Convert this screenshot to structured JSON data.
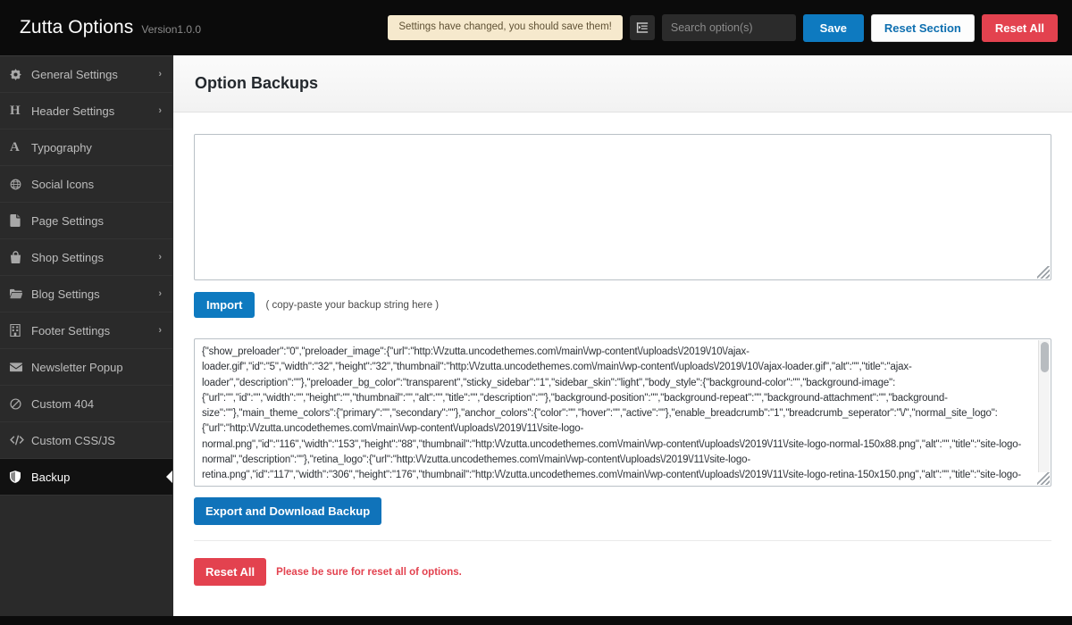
{
  "header": {
    "brand_title": "Zutta Options",
    "version": "Version1.0.0",
    "notice": "Settings have changed, you should save them!",
    "collapse_icon": "collapse-sidebar-icon",
    "search_placeholder": "Search option(s)",
    "search_value": "",
    "save_label": "Save",
    "reset_section_label": "Reset Section",
    "reset_all_label": "Reset All",
    "colors": {
      "bar_bg": "#0b0b0b",
      "notice_bg": "#f6e9cd",
      "primary_blue": "#0e7ac0",
      "danger_red": "#e3424f"
    }
  },
  "sidebar": {
    "items": [
      {
        "label": "General Settings",
        "icon": "gear-icon",
        "has_arrow": true,
        "active": false
      },
      {
        "label": "Header Settings",
        "icon": "letter-h-icon",
        "has_arrow": true,
        "active": false
      },
      {
        "label": "Typography",
        "icon": "letter-a-icon",
        "has_arrow": false,
        "active": false
      },
      {
        "label": "Social Icons",
        "icon": "globe-icon",
        "has_arrow": false,
        "active": false
      },
      {
        "label": "Page Settings",
        "icon": "page-file-icon",
        "has_arrow": false,
        "active": false
      },
      {
        "label": "Shop Settings",
        "icon": "shopping-bag-icon",
        "has_arrow": true,
        "active": false
      },
      {
        "label": "Blog Settings",
        "icon": "folder-icon",
        "has_arrow": true,
        "active": false
      },
      {
        "label": "Footer Settings",
        "icon": "building-columns-icon",
        "has_arrow": true,
        "active": false
      },
      {
        "label": "Newsletter Popup",
        "icon": "envelope-icon",
        "has_arrow": false,
        "active": false
      },
      {
        "label": "Custom 404",
        "icon": "ban-icon",
        "has_arrow": false,
        "active": false
      },
      {
        "label": "Custom CSS/JS",
        "icon": "code-icon",
        "has_arrow": false,
        "active": false
      },
      {
        "label": "Backup",
        "icon": "shield-icon",
        "has_arrow": false,
        "active": true
      }
    ],
    "arrow_glyph": "›"
  },
  "main": {
    "page_title": "Option Backups",
    "import_textarea_value": "",
    "import_button_label": "Import",
    "import_hint": "( copy-paste your backup string here )",
    "export_textarea_value": "{\"show_preloader\":\"0\",\"preloader_image\":{\"url\":\"http:\\/\\/zutta.uncodethemes.com\\/main\\/wp-content\\/uploads\\/2019\\/10\\/ajax-loader.gif\",\"id\":\"5\",\"width\":\"32\",\"height\":\"32\",\"thumbnail\":\"http:\\/\\/zutta.uncodethemes.com\\/main\\/wp-content\\/uploads\\/2019\\/10\\/ajax-loader.gif\",\"alt\":\"\",\"title\":\"ajax-loader\",\"description\":\"\"},\"preloader_bg_color\":\"transparent\",\"sticky_sidebar\":\"1\",\"sidebar_skin\":\"light\",\"body_style\":{\"background-color\":\"\",\"background-image\":{\"url\":\"\",\"id\":\"\",\"width\":\"\",\"height\":\"\",\"thumbnail\":\"\",\"alt\":\"\",\"title\":\"\",\"description\":\"\"},\"background-position\":\"\",\"background-repeat\":\"\",\"background-attachment\":\"\",\"background-size\":\"\"},\"main_theme_colors\":{\"primary\":\"\",\"secondary\":\"\"},\"anchor_colors\":{\"color\":\"\",\"hover\":\"\",\"active\":\"\"},\"enable_breadcrumb\":\"1\",\"breadcrumb_seperator\":\"\\/\",\"normal_site_logo\":{\"url\":\"http:\\/\\/zutta.uncodethemes.com\\/main\\/wp-content\\/uploads\\/2019\\/11\\/site-logo-normal.png\",\"id\":\"116\",\"width\":\"153\",\"height\":\"88\",\"thumbnail\":\"http:\\/\\/zutta.uncodethemes.com\\/main\\/wp-content\\/uploads\\/2019\\/11\\/site-logo-normal-150x88.png\",\"alt\":\"\",\"title\":\"site-logo-normal\",\"description\":\"\"},\"retina_logo\":{\"url\":\"http:\\/\\/zutta.uncodethemes.com\\/main\\/wp-content\\/uploads\\/2019\\/11\\/site-logo-retina.png\",\"id\":\"117\",\"width\":\"306\",\"height\":\"176\",\"thumbnail\":\"http:\\/\\/zutta.uncodethemes.com\\/main\\/wp-content\\/uploads\\/2019\\/11\\/site-logo-retina-150x150.png\",\"alt\":\"\",\"title\":\"site-logo-",
    "export_button_label": "Export and Download Backup",
    "reset_all_label": "Reset All",
    "reset_note": "Please be sure for reset all of options."
  }
}
